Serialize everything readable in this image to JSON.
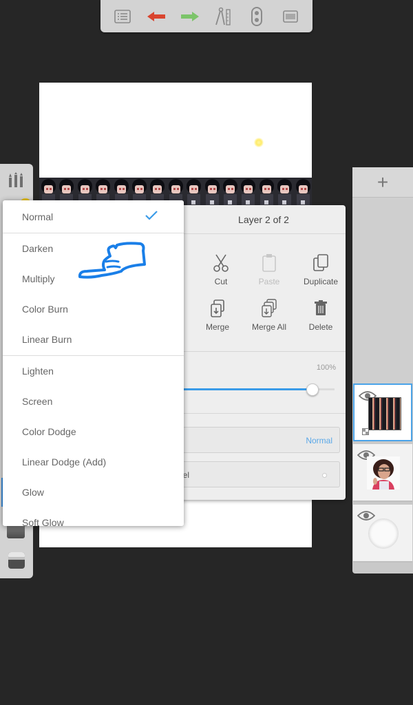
{
  "toolbar": {
    "icons": [
      "list-icon",
      "undo-icon",
      "redo-icon",
      "ruler-icon",
      "symmetry-icon",
      "fullscreen-icon"
    ],
    "undo_color": "#d9452f",
    "redo_color": "#7cc46a"
  },
  "layer_panel": {
    "title": "Layer 2 of 2",
    "actions": [
      {
        "label": "Cut",
        "enabled": true
      },
      {
        "label": "Paste",
        "enabled": false
      },
      {
        "label": "Duplicate",
        "enabled": true
      },
      {
        "label": "Merge",
        "enabled": true
      },
      {
        "label": "Merge All",
        "enabled": true
      },
      {
        "label": "Delete",
        "enabled": true
      }
    ],
    "opacity_label": "100%",
    "opacity": 100,
    "blending_label": "g",
    "blending_value": "Normal",
    "label_row": "bel"
  },
  "blend_menu": {
    "selected": "Normal",
    "items": [
      "Normal",
      "Darken",
      "Multiply",
      "Color Burn",
      "Linear Burn",
      "Lighten",
      "Screen",
      "Color Dodge",
      "Linear Dodge (Add)",
      "Glow",
      "Soft Glow"
    ]
  },
  "layers": {
    "add_label": "+",
    "items": [
      {
        "name": "sprite-layer",
        "selected": true
      },
      {
        "name": "portrait-layer",
        "selected": false
      },
      {
        "name": "background-layer",
        "selected": false
      }
    ]
  },
  "colors": {
    "accent": "#3a9be8",
    "annotation": "#1a7fe8",
    "background": "#262626"
  }
}
